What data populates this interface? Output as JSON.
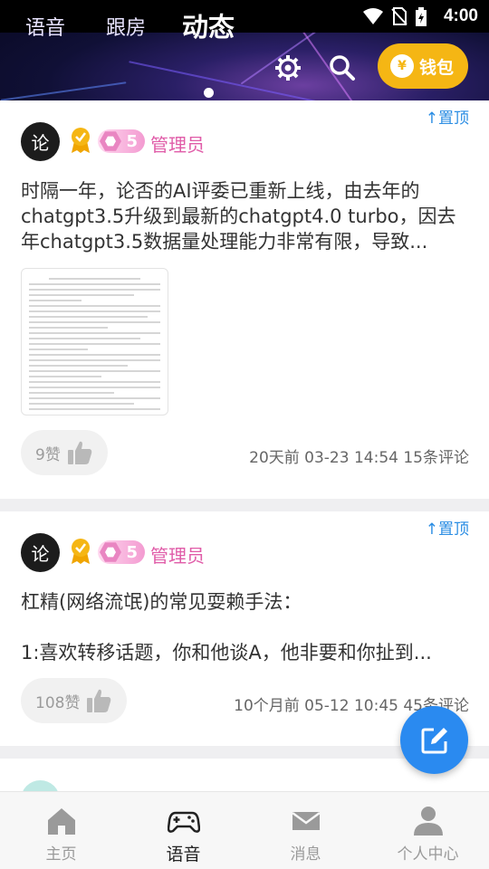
{
  "status_bar": {
    "time": "4:00"
  },
  "nav": {
    "tabs": [
      {
        "label": "语音"
      },
      {
        "label": "跟房"
      },
      {
        "label": "动态",
        "active": true
      }
    ],
    "wallet_label": "钱包",
    "wallet_icon_glyph": "¥",
    "icons": [
      "settings-icon",
      "search-icon"
    ]
  },
  "posts": [
    {
      "pin_label": "↑置顶",
      "avatar_glyph": "论",
      "level": "5",
      "role": "管理员",
      "lines": [
        "时隔一年，论否的AI评委已重新上线，由去年的",
        "chatgpt3.5升级到最新的chatgpt4.0 turbo，因去",
        "年chatgpt3.5数据量处理能力非常有限，导致..."
      ],
      "has_image": true,
      "likes": "9赞",
      "meta": "20天前 03-23 14:54 15条评论"
    },
    {
      "pin_label": "↑置顶",
      "avatar_glyph": "论",
      "level": "5",
      "role": "管理员",
      "lines": [
        "杠精(网络流氓)的常见耍赖手法：",
        "",
        "1:喜欢转移话题，你和他谈A，他非要和你扯到..."
      ],
      "has_image": false,
      "likes": "108赞",
      "meta": "10个月前 05-12 10:45 45条评论"
    }
  ],
  "bottom_nav": [
    {
      "label": "主页",
      "icon": "home-icon"
    },
    {
      "label": "语音",
      "icon": "gamepad-icon",
      "active": true
    },
    {
      "label": "消息",
      "icon": "mail-icon"
    },
    {
      "label": "个人中心",
      "icon": "person-icon"
    }
  ],
  "colors": {
    "accent": "#2a8af0",
    "wallet": "#f5b614",
    "role": "#e05ca8",
    "pin": "#2b8de3"
  }
}
